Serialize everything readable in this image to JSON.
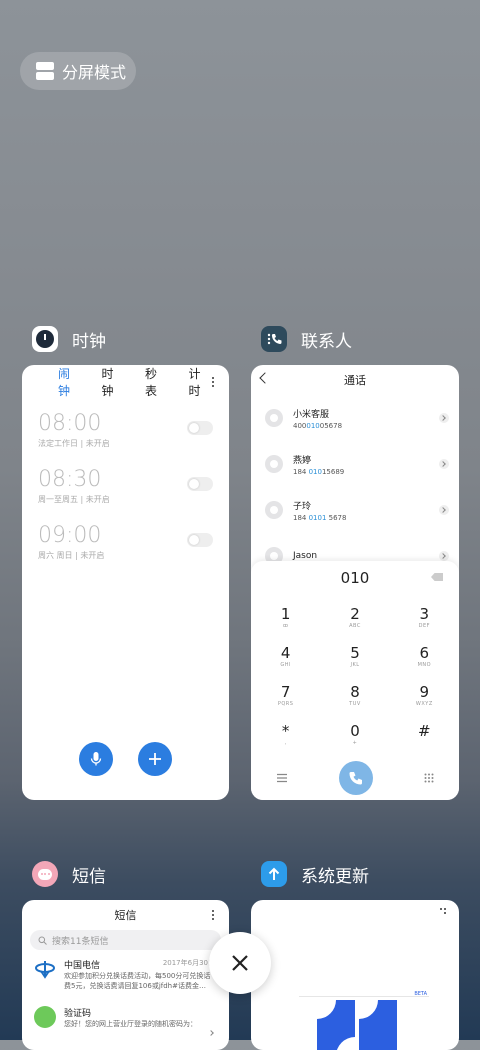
{
  "split_mode": {
    "label": "分屏模式",
    "icon": "split-screen-icon"
  },
  "clock": {
    "app_name": "时钟",
    "tabs": [
      "闹钟",
      "时钟",
      "秒表",
      "计时"
    ],
    "alarms": [
      {
        "time": "08:00",
        "sub": "法定工作日 | 未开启"
      },
      {
        "time": "08:30",
        "sub": "周一至周五 | 未开启"
      },
      {
        "time": "09:00",
        "sub": "周六 周日 | 未开启"
      }
    ]
  },
  "contacts": {
    "app_name": "联系人",
    "title": "通话",
    "list": [
      {
        "name": "小米客服",
        "num_a": "400",
        "num_b": "010",
        "num_c": "05678"
      },
      {
        "name": "燕婷",
        "num_a": "184 ",
        "num_b": "010",
        "num_c": "15689"
      },
      {
        "name": "子玲",
        "num_a": "184 ",
        "num_b": "0101",
        "num_c": " 5678"
      },
      {
        "name": "Jason",
        "num_a": "",
        "num_b": "",
        "num_c": ""
      }
    ],
    "dial_input": "010",
    "keys": [
      {
        "k": "1",
        "l": "ꝏ"
      },
      {
        "k": "2",
        "l": "ABC"
      },
      {
        "k": "3",
        "l": "DEF"
      },
      {
        "k": "4",
        "l": "GHI"
      },
      {
        "k": "5",
        "l": "JKL"
      },
      {
        "k": "6",
        "l": "MNO"
      },
      {
        "k": "7",
        "l": "PQRS"
      },
      {
        "k": "8",
        "l": "TUV"
      },
      {
        "k": "9",
        "l": "WXYZ"
      },
      {
        "k": "*",
        "l": ","
      },
      {
        "k": "0",
        "l": "+"
      },
      {
        "k": "#",
        "l": ""
      }
    ]
  },
  "messages": {
    "app_name": "短信",
    "title": "短信",
    "search_placeholder": "搜索11条短信",
    "items": [
      {
        "name": "中国电信",
        "date": "2017年6月30日",
        "preview": "欢迎参加积分兑换话费活动，每500分可兑换话费5元，兑换话费请回复106或jfdh#话费金…"
      },
      {
        "name": "验证码",
        "date": "",
        "preview": "您好！您的网上营业厅登录的随机密码为："
      }
    ]
  },
  "updater": {
    "app_name": "系统更新",
    "badge": "BETA"
  },
  "colors": {
    "accent": "#2b7de0",
    "link": "#2b8fd6"
  }
}
